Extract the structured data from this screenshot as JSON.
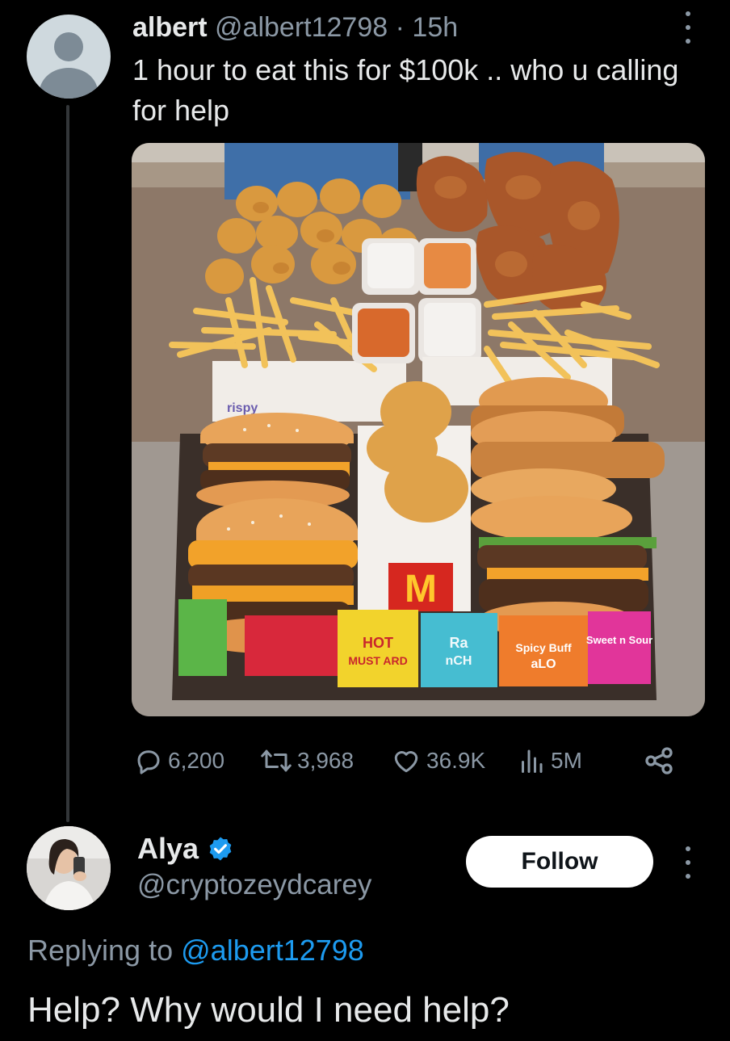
{
  "colors": {
    "background": "#000000",
    "primary_text": "#e7e9ea",
    "secondary_text": "#8b98a5",
    "link": "#1d9bf0",
    "verified_badge": "#1d9bf0",
    "thread_line": "#333639"
  },
  "post": {
    "author_name": "albert",
    "author_handle": "@albert12798",
    "separator": "·",
    "timestamp": "15h",
    "text": "1 hour to eat this for $100k .. who u calling for help",
    "avatar_icon": "default-profile-icon",
    "more_icon": "more-options-icon",
    "media": {
      "icon": "photo-fast-food-tray",
      "packet_labels": [
        "HOT MUST ARD",
        "Ra nCH",
        "Spicy Buff aLO",
        "Sweet n Sour"
      ]
    },
    "actions": {
      "replies": {
        "icon": "reply-icon",
        "count": "6,200"
      },
      "reposts": {
        "icon": "repost-icon",
        "count": "3,968"
      },
      "likes": {
        "icon": "heart-icon",
        "count": "36.9K"
      },
      "views": {
        "icon": "views-chart-icon",
        "count": "5M"
      },
      "share": {
        "icon": "share-icon"
      }
    }
  },
  "reply": {
    "author_name": "Alya",
    "verified": true,
    "verified_icon": "verified-badge-icon",
    "author_handle": "@cryptozeydcarey",
    "follow_label": "Follow",
    "more_icon": "more-options-icon",
    "replying_prefix": "Replying to",
    "replying_mention": "@albert12798",
    "text": "Help? Why would I need help?"
  }
}
